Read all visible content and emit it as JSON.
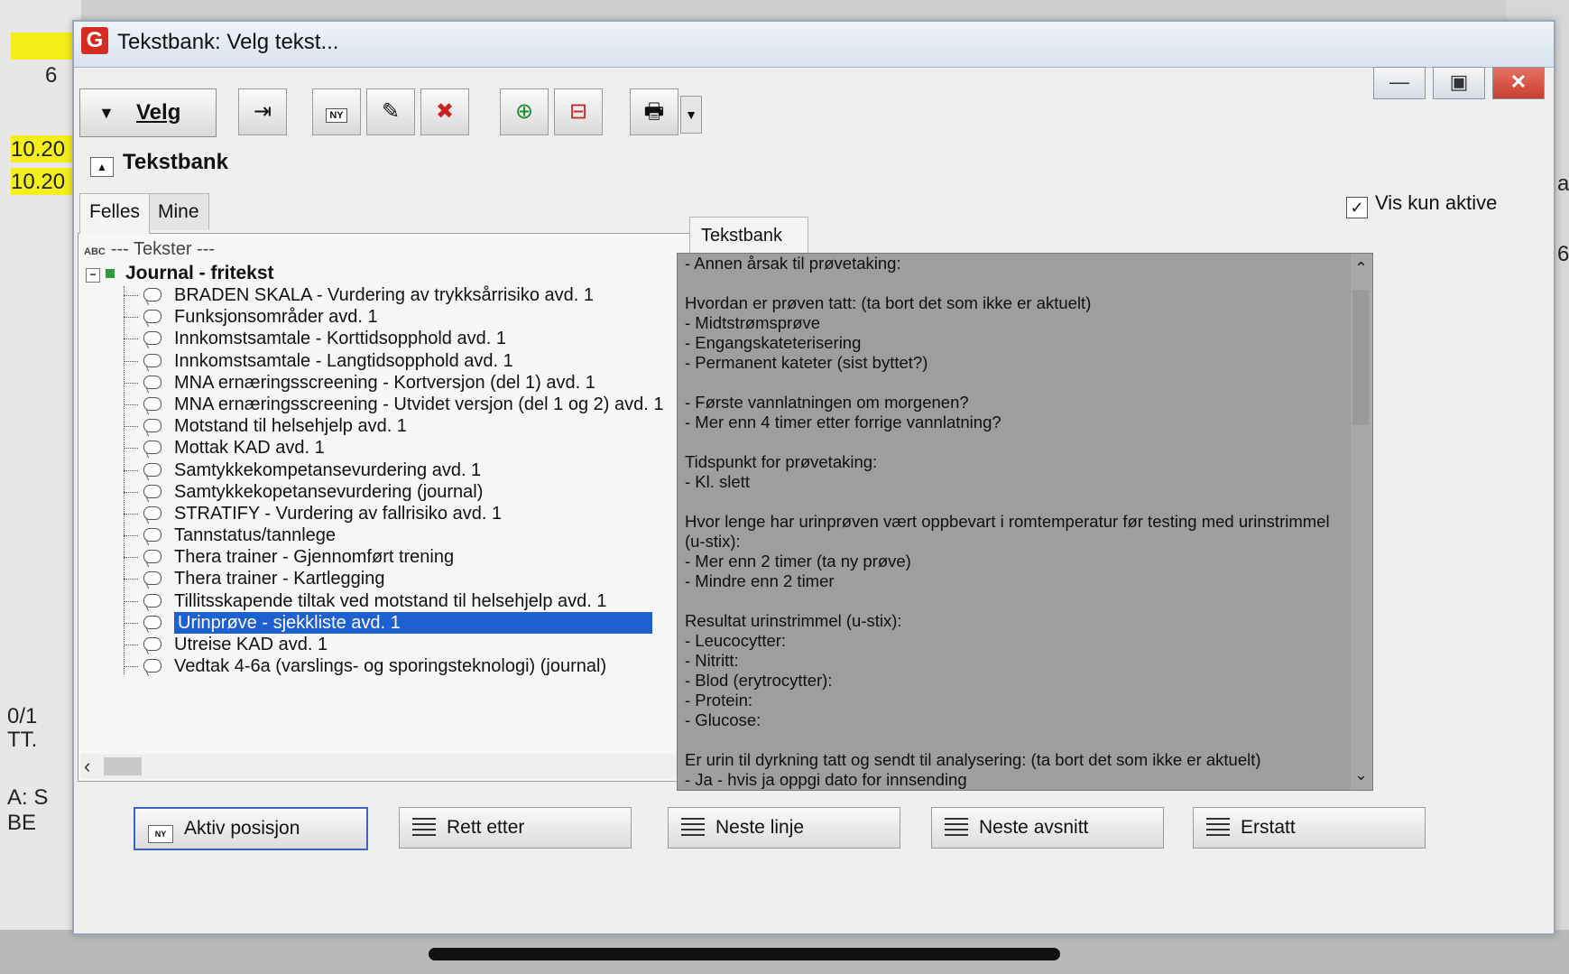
{
  "background": {
    "left_numbers": [
      "6",
      "10.20",
      "10.20",
      "0/1",
      "TT.",
      "A: S",
      "BE"
    ],
    "right_numbers": [
      "a",
      "6"
    ]
  },
  "window": {
    "title": "Tekstbank: Velg tekst...",
    "logo_letter": "G"
  },
  "toolbar": {
    "velg_label": "Velg",
    "buttons": [
      "exit-icon",
      "ny-icon",
      "edit-icon",
      "delete-icon",
      "add-icon",
      "remove-icon",
      "print-icon"
    ]
  },
  "section": {
    "title": "Tekstbank"
  },
  "tabs": {
    "felles": "Felles",
    "mine": "Mine",
    "right": "Tekstbank"
  },
  "filter": {
    "vis_kun_aktive": "Vis kun aktive",
    "checked": true
  },
  "tree": {
    "root": "--- Tekster ---",
    "group": "Journal - fritekst",
    "items": [
      "BRADEN SKALA - Vurdering av trykksårrisiko avd. 1",
      "Funksjonsområder avd. 1",
      "Innkomstsamtale - Korttidsopphold avd. 1",
      "Innkomstsamtale - Langtidsopphold avd. 1",
      "MNA ernæringsscreening - Kortversjon (del 1) avd. 1",
      "MNA ernæringsscreening - Utvidet versjon (del 1 og 2) avd. 1",
      "Motstand til helsehjelp avd. 1",
      "Mottak KAD avd. 1",
      "Samtykkekompetansevurdering avd. 1",
      "Samtykkekopetansevurdering (journal)",
      "STRATIFY - Vurdering av fallrisiko avd. 1",
      "Tannstatus/tannlege",
      "Thera trainer - Gjennomført trening",
      "Thera trainer - Kartlegging",
      "Tillitsskapende tiltak ved motstand til helsehjelp avd. 1",
      "Urinprøve - sjekkliste avd. 1",
      "Utreise KAD avd. 1",
      "Vedtak 4-6a (varslings- og sporingsteknologi) (journal)"
    ],
    "selected_index": 15
  },
  "text_panel": {
    "content": "- Annen årsak til prøvetaking:\n\nHvordan er prøven tatt: (ta bort det som ikke er aktuelt)\n- Midtstrømsprøve\n- Engangskateterisering\n- Permanent kateter (sist byttet?)\n\n- Første vannlatningen om morgenen?\n- Mer enn 4 timer etter forrige vannlatning?\n\nTidspunkt for prøvetaking:\n- Kl. slett\n\nHvor lenge har urinprøven vært oppbevart i romtemperatur før testing med urinstrimmel\n(u-stix):\n- Mer enn 2 timer (ta ny prøve)\n- Mindre enn 2 timer\n\nResultat urinstrimmel (u-stix):\n- Leucocytter:\n- Nitritt:\n- Blod (erytrocytter):\n- Protein:\n- Glucose:\n\nEr urin til dyrkning tatt og sendt til analysering: (ta bort det som ikke er aktuelt)\n- Ja - hvis ja oppgi dato for innsending\n- Nei"
  },
  "actions": {
    "aktiv_posisjon": "Aktiv posisjon",
    "rett_etter": "Rett etter",
    "neste_linje": "Neste linje",
    "neste_avsnitt": "Neste avsnitt",
    "erstatt": "Erstatt"
  },
  "colors": {
    "selection": "#1e5fd2",
    "text_panel_bg": "#9e9e9e",
    "close_button": "#c9402e",
    "logo": "#d62b1f",
    "background_yellow": "#f4ee1a"
  }
}
